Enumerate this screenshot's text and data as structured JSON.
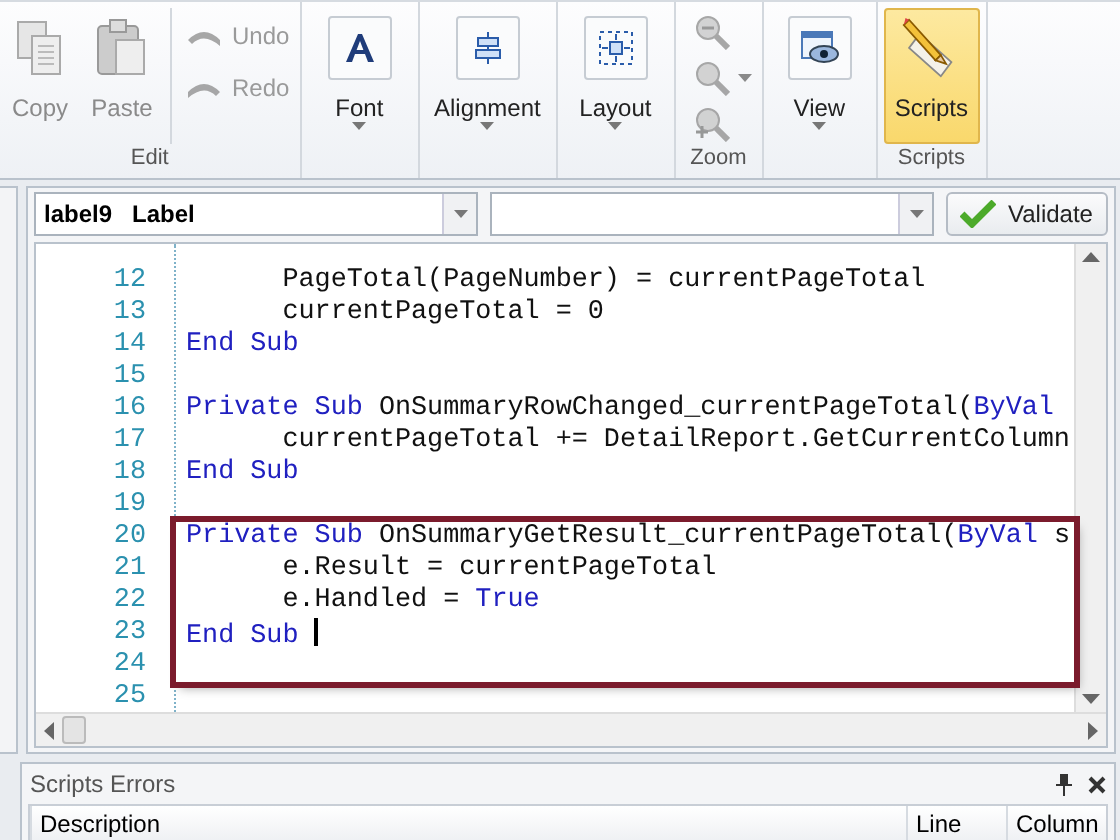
{
  "ribbon": {
    "groups": [
      {
        "label": "Edit",
        "items": [
          {
            "kind": "large",
            "label": "Copy",
            "disabled": true,
            "selected": false,
            "dropdown": false
          },
          {
            "kind": "large",
            "label": "Paste",
            "disabled": true,
            "selected": false,
            "dropdown": false
          },
          {
            "kind": "small",
            "label": "Undo",
            "disabled": true,
            "dropdown": false
          },
          {
            "kind": "small",
            "label": "Redo",
            "disabled": true,
            "dropdown": false
          }
        ]
      },
      {
        "items": [
          {
            "kind": "large",
            "label": "Font",
            "disabled": false,
            "selected": false,
            "dropdown": true
          }
        ]
      },
      {
        "items": [
          {
            "kind": "large",
            "label": "Alignment",
            "disabled": false,
            "selected": false,
            "dropdown": true
          }
        ]
      },
      {
        "items": [
          {
            "kind": "large",
            "label": "Layout",
            "disabled": false,
            "selected": false,
            "dropdown": true
          }
        ]
      },
      {
        "label": "Zoom",
        "items": [
          {
            "kind": "small",
            "disabled": true,
            "dropdown": false
          },
          {
            "kind": "small",
            "disabled": true,
            "dropdown": true
          },
          {
            "kind": "small",
            "disabled": true,
            "dropdown": false
          }
        ]
      },
      {
        "items": [
          {
            "kind": "large",
            "label": "View",
            "disabled": false,
            "selected": false,
            "dropdown": true
          }
        ]
      },
      {
        "label": "Scripts",
        "items": [
          {
            "kind": "large",
            "label": "Scripts",
            "disabled": false,
            "selected": true,
            "dropdown": false
          }
        ]
      }
    ]
  },
  "editor": {
    "control_combo": {
      "value": "label9   Label"
    },
    "validate_button": "Validate"
  },
  "code": {
    "lines": [
      {
        "number": "12",
        "tokens": [
          {
            "kind": "plain",
            "text": "      PageTotal(PageNumber) = currentPageTotal"
          }
        ]
      },
      {
        "number": "13",
        "tokens": [
          {
            "kind": "plain",
            "text": "      currentPageTotal = 0"
          }
        ]
      },
      {
        "number": "14",
        "tokens": [
          {
            "kind": "keyword",
            "text": "End Sub"
          }
        ]
      },
      {
        "number": "15"
      },
      {
        "number": "16",
        "tokens": [
          {
            "kind": "keyword",
            "text": "Private Sub"
          },
          {
            "kind": "plain",
            "text": " OnSummaryRowChanged_currentPageTotal("
          },
          {
            "kind": "keyword",
            "text": "ByVal"
          }
        ]
      },
      {
        "number": "17",
        "tokens": [
          {
            "kind": "plain",
            "text": "      currentPageTotal += DetailReport.GetCurrentColumn"
          }
        ]
      },
      {
        "number": "18",
        "tokens": [
          {
            "kind": "keyword",
            "text": "End Sub"
          }
        ]
      },
      {
        "number": "19"
      },
      {
        "number": "20",
        "highlighted": true,
        "tokens": [
          {
            "kind": "keyword",
            "text": "Private Sub"
          },
          {
            "kind": "plain",
            "text": " OnSummaryGetResult_currentPageTotal("
          },
          {
            "kind": "keyword",
            "text": "ByVal"
          },
          {
            "kind": "plain",
            "text": " s"
          }
        ]
      },
      {
        "number": "21",
        "highlighted": true,
        "tokens": [
          {
            "kind": "plain",
            "text": "      e.Result = currentPageTotal"
          }
        ]
      },
      {
        "number": "22",
        "highlighted": true,
        "tokens": [
          {
            "kind": "plain",
            "text": "      e.Handled = "
          },
          {
            "kind": "keyword",
            "text": "True"
          }
        ]
      },
      {
        "number": "23",
        "highlighted": true,
        "cursor": true,
        "tokens": [
          {
            "kind": "keyword",
            "text": "End Sub"
          }
        ]
      },
      {
        "number": "24",
        "highlighted": true
      },
      {
        "number": "25"
      }
    ]
  },
  "errors_panel": {
    "title": "Scripts Errors",
    "columns": [
      "Description",
      "Line",
      "Column"
    ]
  }
}
